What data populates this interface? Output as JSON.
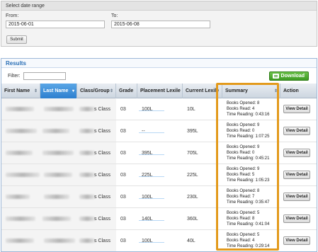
{
  "date_range": {
    "title": "Select date range",
    "from_label": "From:",
    "from_value": "2015-06-01",
    "to_label": "To:",
    "to_value": "2015-06-08",
    "submit_label": "Submit"
  },
  "results": {
    "title": "Results",
    "filter_label": "Filter:",
    "filter_value": "",
    "download_label": "Download",
    "columns": [
      "First Name",
      "Last Name",
      "Class/Group",
      "Grade",
      "Placement Lexile",
      "Current Lexile",
      "Summary",
      "Action"
    ],
    "rows": [
      {
        "class": "s Class",
        "grade": "03",
        "placement": "100L",
        "current": "10L",
        "books_opened": "Books Opened: 8",
        "books_read": "Books Read: 4",
        "time_reading": "Time Reading: 0:43:16",
        "action": "View Detail"
      },
      {
        "class": "s Class",
        "grade": "03",
        "placement": "--",
        "current": "395L",
        "books_opened": "Books Opened: 9",
        "books_read": "Books Read: 0",
        "time_reading": "Time Reading: 1:07:25",
        "action": "View Detail"
      },
      {
        "class": "s Class",
        "grade": "03",
        "placement": "395L",
        "current": "705L",
        "books_opened": "Books Opened: 9",
        "books_read": "Books Read: 0",
        "time_reading": "Time Reading: 0:45:21",
        "action": "View Detail"
      },
      {
        "class": "s Class",
        "grade": "03",
        "placement": "225L",
        "current": "225L",
        "books_opened": "Books Opened: 9",
        "books_read": "Books Read: 5",
        "time_reading": "Time Reading: 1:05:23",
        "action": "View Detail"
      },
      {
        "class": "s Class",
        "grade": "03",
        "placement": "100L",
        "current": "230L",
        "books_opened": "Books Opened: 8",
        "books_read": "Books Read: 7",
        "time_reading": "Time Reading: 0:35:47",
        "action": "View Detail"
      },
      {
        "class": "s Class",
        "grade": "03",
        "placement": "140L",
        "current": "360L",
        "books_opened": "Books Opened: 5",
        "books_read": "Books Read: 8",
        "time_reading": "Time Reading: 0:41:04",
        "action": "View Detail"
      },
      {
        "class": "s Class",
        "grade": "03",
        "placement": "100L",
        "current": "40L",
        "books_opened": "Books Opened: 5",
        "books_read": "Books Read: 4",
        "time_reading": "Time Reading: 0:29:14",
        "action": "View Detail"
      }
    ]
  },
  "colors": {
    "accent": "#2d7fcf",
    "download": "#3e9a24",
    "highlight": "#e39a1c"
  }
}
